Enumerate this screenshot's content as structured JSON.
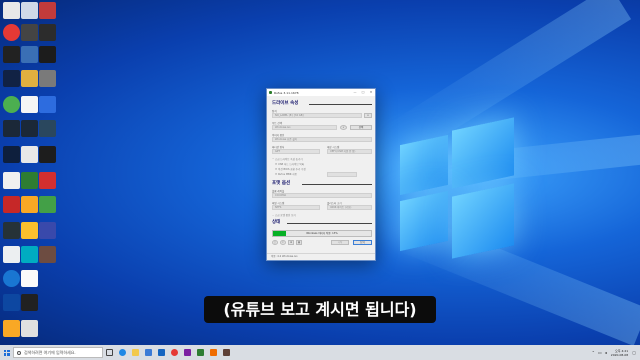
{
  "window": {
    "title": "Rufus 3.11.1678",
    "minimize": "—",
    "maximize": "□",
    "close": "✕",
    "drive_props_heading": "드라이브 속성",
    "device_label": "장치",
    "device_value": "NO_LABEL (E:) [32 GB]",
    "boot_select_label": "부트 선택",
    "boot_select_value": "Windows.iso",
    "select_button": "선택",
    "image_option_label": "이미지 옵션",
    "image_option_value": "Windows 표준 설치",
    "partition_label": "파티션 방식",
    "partition_value": "GPT",
    "target_label": "대상 시스템",
    "target_value": "UEFI (CSM 지원 안 함)",
    "advanced_drive": "고급 드라이브 속성 숨기기",
    "adv_opt1": "USB 하드 드라이브 목록",
    "adv_opt2": "이전 BIOS 호환 추가 수정",
    "adv_opt3": "Rufus MBR 사용",
    "format_heading": "포맷 옵션",
    "volume_label": "볼륨 레이블",
    "volume_value": "CCCOMA",
    "fs_label": "파일 시스템",
    "fs_value": "NTFS",
    "cluster_label": "클러스터 크기",
    "cluster_value": "4096 바이트 (기본)",
    "advanced_format": "고급 포맷 옵션 보기",
    "status_heading": "상태",
    "progress_text": "Windows 이미지 적용: 13%",
    "start_button": "시작",
    "close_button": "닫기",
    "statusbar_text": "이용: 4.2 Windows.iso"
  },
  "progress": {
    "fraction": 0.13
  },
  "subtitle": "(유튜브 보고 계시면 됩니다)",
  "taskbar": {
    "search_placeholder": "검색하려면 여기에 입력하세요.",
    "clock_time": "오후 4:21",
    "clock_date": "2020-08-08"
  },
  "colors": {
    "progress_fill": "#06b025",
    "section_heading": "#1b1b6e",
    "taskbar_bg": "#d9dde3"
  }
}
